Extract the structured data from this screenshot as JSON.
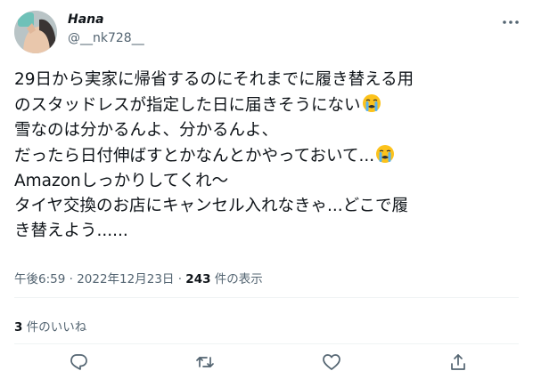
{
  "user": {
    "display_name": "Hana",
    "handle": "@__nk728__"
  },
  "tweet": {
    "lines": [
      "29日から実家に帰省するのにそれまでに履き替える用",
      "のスタッドレスが指定した日に届きそうにない",
      "雪なのは分かるんよ、分かるんよ、",
      "だったら日付伸ばすとかなんとかやっておいて...",
      "Amazonしっかりしてくれ〜",
      "タイヤ交換のお店にキャンセル入れなきゃ...どこで履",
      "き替えよう......"
    ],
    "emoji": "loudly-crying-face"
  },
  "meta": {
    "time": "午後6:59",
    "sep1": " · ",
    "date": "2022年12月23日",
    "sep2": " · ",
    "view_count": "243",
    "view_label": " 件の表示"
  },
  "likes": {
    "count": "3",
    "label": " 件のいいね"
  },
  "colors": {
    "text": "#0f1419",
    "secondary": "#536471",
    "divider": "#eff3f4"
  }
}
